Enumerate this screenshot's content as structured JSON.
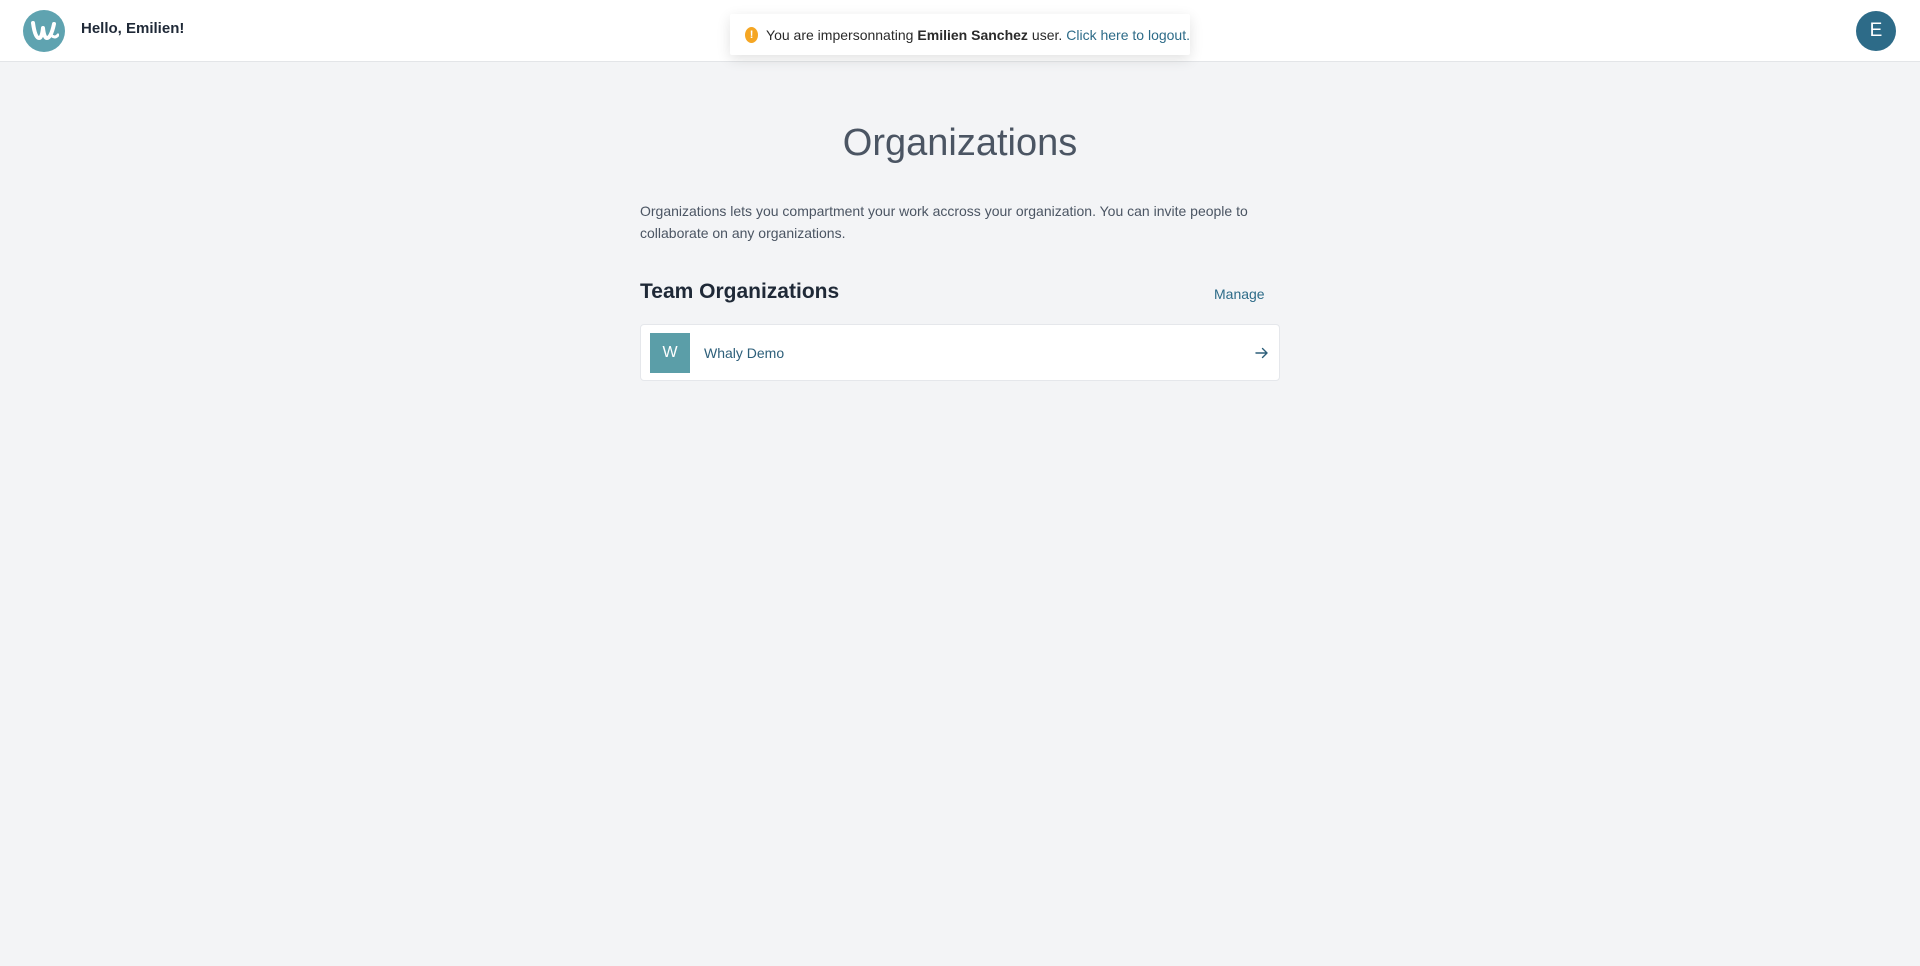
{
  "header": {
    "greeting": "Hello, Emilien!",
    "avatar_initial": "E",
    "brand_color": "#5fa3b0",
    "avatar_color": "#2d6b88"
  },
  "impersonation_banner": {
    "icon": "warning-icon",
    "icon_glyph": "!",
    "prefix": "You are impersonnating",
    "user_name": "Emilien Sanchez",
    "suffix": "user.",
    "logout_link": "Click here to logout."
  },
  "page": {
    "title": "Organizations",
    "description": "Organizations lets you compartment your work accross your organization. You can invite people to collaborate on any organizations."
  },
  "team_organizations": {
    "heading": "Team Organizations",
    "manage_label": "Manage",
    "items": [
      {
        "initial": "W",
        "name": "Whaly Demo",
        "icon": "arrow-right-icon"
      }
    ]
  }
}
